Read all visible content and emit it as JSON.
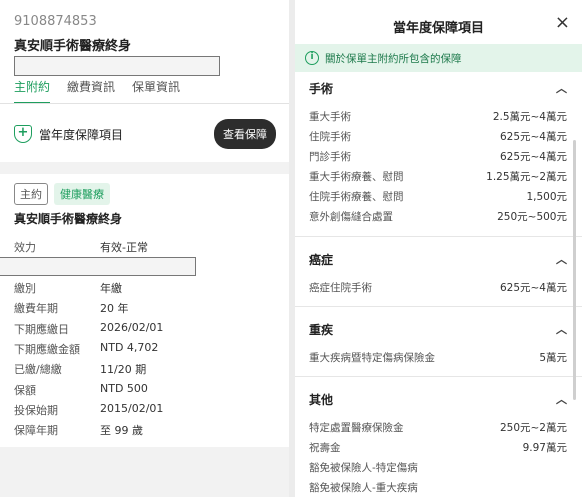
{
  "left": {
    "policy_number": "9108874853",
    "policy_name": "真安順手術醫療終身",
    "tabs": [
      {
        "label": "主附約",
        "active": true
      },
      {
        "label": "繳費資訊",
        "active": false
      },
      {
        "label": "保單資訊",
        "active": false
      }
    ],
    "coverage_label": "當年度保障項目",
    "view_button": "查看保障",
    "tag_contract": "主約",
    "tag_type": "健康醫療",
    "plan_name": "真安順手術醫療終身",
    "info_rows": [
      {
        "label": "效力",
        "value": "有效-正常"
      },
      {
        "label": "繳別",
        "value": "年繳"
      },
      {
        "label": "繳費年期",
        "value": "20 年"
      },
      {
        "label": "下期應繳日",
        "value": "2026/02/01"
      },
      {
        "label": "下期應繳金額",
        "value": "NTD 4,702"
      },
      {
        "label": "已繳/總繳",
        "value": "11/20 期"
      },
      {
        "label": "保額",
        "value": "NTD 500"
      },
      {
        "label": "投保始期",
        "value": "2015/02/01"
      },
      {
        "label": "保障年期",
        "value": "至 99 歲"
      }
    ]
  },
  "right": {
    "title": "當年度保障項目",
    "close_icon": "×",
    "notice": "關於保單主附約所包含的保障",
    "sections": [
      {
        "title": "手術",
        "items": [
          {
            "name": "重大手術",
            "amount": "2.5萬元~4萬元"
          },
          {
            "name": "住院手術",
            "amount": "625元~4萬元"
          },
          {
            "name": "門診手術",
            "amount": "625元~4萬元"
          },
          {
            "name": "重大手術療養、慰問",
            "amount": "1.25萬元~2萬元"
          },
          {
            "name": "住院手術療養、慰問",
            "amount": "1,500元"
          },
          {
            "name": "意外創傷縫合處置",
            "amount": "250元~500元"
          }
        ]
      },
      {
        "title": "癌症",
        "items": [
          {
            "name": "癌症住院手術",
            "amount": "625元~4萬元"
          }
        ]
      },
      {
        "title": "重疾",
        "items": [
          {
            "name": "重大疾病暨特定傷病保險金",
            "amount": "5萬元"
          }
        ]
      },
      {
        "title": "其他",
        "items": [
          {
            "name": "特定處置醫療保險金",
            "amount": "250元~2萬元"
          },
          {
            "name": "祝壽金",
            "amount": "9.97萬元"
          },
          {
            "name": "豁免被保險人-特定傷病",
            "amount": ""
          },
          {
            "name": "豁免被保險人-重大疾病",
            "amount": ""
          }
        ]
      }
    ]
  }
}
